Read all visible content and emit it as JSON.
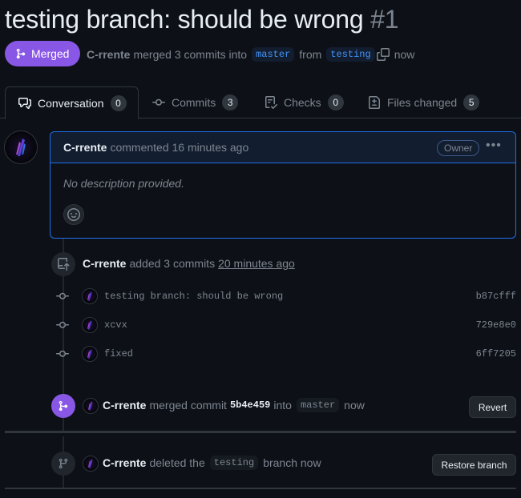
{
  "pr": {
    "title": "testing branch: should be wrong",
    "number": "#1",
    "status": "Merged",
    "author": "C-rrente",
    "merged_text": "merged 3 commits into",
    "base_branch": "master",
    "from_text": "from",
    "head_branch": "testing",
    "time": "now"
  },
  "tabs": [
    {
      "label": "Conversation",
      "count": "0"
    },
    {
      "label": "Commits",
      "count": "3"
    },
    {
      "label": "Checks",
      "count": "0"
    },
    {
      "label": "Files changed",
      "count": "5"
    }
  ],
  "comment": {
    "author": "C-rrente",
    "action": "commented 16 minutes ago",
    "role": "Owner",
    "body": "No description provided."
  },
  "commits_event": {
    "author": "C-rrente",
    "action": "added 3 commits",
    "time": "20 minutes ago",
    "commits": [
      {
        "message": "testing branch: should be wrong",
        "sha": "b87cfff"
      },
      {
        "message": "xcvx",
        "sha": "729e8e0"
      },
      {
        "message": "fixed",
        "sha": "6ff7205"
      }
    ]
  },
  "merge_event": {
    "author": "C-rrente",
    "action": "merged commit",
    "sha": "5b4e459",
    "into": "into",
    "branch": "master",
    "time": "now",
    "button": "Revert"
  },
  "delete_event": {
    "author": "C-rrente",
    "action": "deleted the",
    "branch": "testing",
    "suffix": "branch now",
    "button": "Restore branch"
  },
  "colors": {
    "merged": "#8957e5",
    "accent": "#1f6feb",
    "link": "#4493f8",
    "background": "#0d1117"
  }
}
